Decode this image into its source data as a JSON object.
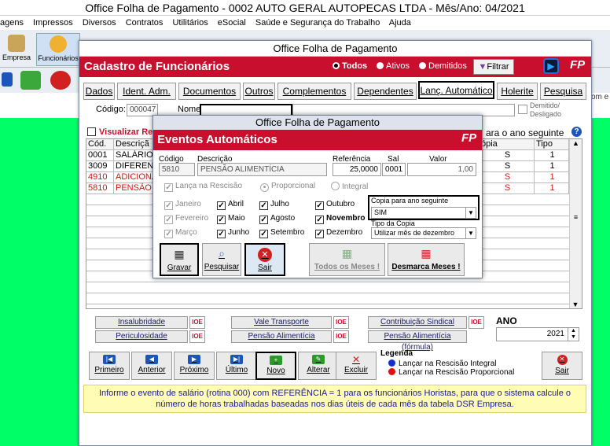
{
  "app": {
    "title": "Office Folha de Pagamento - 0002 AUTO GERAL AUTOPECAS LTDA - Mês/Ano: 04/2021",
    "menu": [
      "agens",
      "Impressos",
      "Diversos",
      "Contratos",
      "Utilitários",
      "eSocial",
      "Saúde e Segurança do Trabalho",
      "Ajuda"
    ],
    "toolbar": {
      "empresa": "Empresa",
      "funcionarios": "Funcionários"
    },
    "right_strip": "om e"
  },
  "cadastro": {
    "window_title": "Office Folha de Pagamento",
    "header_title": "Cadastro de Funcionários",
    "filters": {
      "todos": "Todos",
      "ativos": "Ativos",
      "demitidos": "Demitidos",
      "selected": "todos"
    },
    "filter_button": "Filtrar",
    "logo": "FP",
    "tabs": [
      "Dados",
      "Ident. Adm.",
      "Documentos",
      "Outros",
      "Complementos",
      "Dependentes",
      "Lanç. Automático",
      "Holerite",
      "Pesquisa"
    ],
    "active_tab": "Lanç. Automático",
    "codigo_label": "Código:",
    "codigo_value": "000047",
    "nome_label": "Nome:",
    "nome_value": "",
    "demitido_label": "Demitido/ Desligado",
    "visualizar_label": "Visualizar Ref",
    "copia_header": "ara o ano seguinte",
    "grid": {
      "headers": {
        "cod": "Cód.",
        "descricao": "Descriçã",
        "copia": "ópia",
        "tipo": "Tipo"
      },
      "rows": [
        {
          "cod": "0001",
          "descricao": "SALÁRIO",
          "copia": "S",
          "tipo": "1",
          "red": false
        },
        {
          "cod": "3009",
          "descricao": "DIFEREN",
          "copia": "S",
          "tipo": "1",
          "red": false
        },
        {
          "cod": "4910",
          "descricao": "ADICIONA",
          "copia": "S",
          "tipo": "1",
          "red": true
        },
        {
          "cod": "5810",
          "descricao": "PENSÃO",
          "copia": "S",
          "tipo": "1",
          "red": true
        }
      ]
    },
    "section_buttons": {
      "insalubridade": "Insalubridade",
      "periculosidade": "Periculosidade",
      "vale_transporte": "Vale Transporte",
      "pensao_alimenticia": "Pensão Alimentícia",
      "contribuicao_sindical": "Contribuição Sindical",
      "pensao_formula": "Pensão Alimentícia (fórmula)",
      "ioe": "IOE"
    },
    "ano_label": "ANO",
    "ano_value": "2021",
    "nav": {
      "primeiro": "Primeiro",
      "anterior": "Anterior",
      "proximo": "Próximo",
      "ultimo": "Último",
      "novo": "Novo",
      "alterar": "Alterar",
      "excluir": "Excluir",
      "sair": "Sair"
    },
    "legenda": {
      "title": "Legenda",
      "integral": "Lançar na Rescisão Integral",
      "proporcional": "Lançar na Rescisão Proporcional",
      "integral_color": "#1030d0",
      "proporcional_color": "#e01010"
    },
    "info": "Informe o evento de salário (rotina 000) com REFERÊNCIA = 1 para os funcionários Horistas, para que o sistema calcule o número de horas trabalhadas baseadas nos dias úteis de cada mês da tabela DSR Empresa."
  },
  "eventos": {
    "window_title": "Office Folha de Pagamento",
    "header_title": "Eventos Automáticos",
    "logo": "FP",
    "labels": {
      "codigo": "Código",
      "descricao": "Descrição",
      "referencia": "Referência",
      "sal": "Sal",
      "valor": "Valor"
    },
    "values": {
      "codigo": "5810",
      "descricao": "PENSÃO ALIMENTÍCIA",
      "referencia": "25,0000",
      "sal": "0001",
      "valor": "1,00"
    },
    "lancar_rescisao": "Lança na Rescisão",
    "proporcional": "Proporcional",
    "integral": "Integral",
    "months": {
      "janeiro": "Janeiro",
      "fevereiro": "Fevereiro",
      "marco": "Março",
      "abril": "Abril",
      "maio": "Maio",
      "junho": "Junho",
      "julho": "Julho",
      "agosto": "Agosto",
      "setembro": "Setembro",
      "outubro": "Outubro",
      "novembro": "Novembro",
      "dezembro": "Dezembro"
    },
    "copia_label": "Copia para ano seguinte",
    "copia_value": "SIM",
    "tipo_copia_label": "Tipo da Copia",
    "tipo_copia_value": "Utilizar mês de dezembro",
    "buttons": {
      "gravar": "Gravar",
      "pesquisar": "Pesquisar",
      "sair": "Sair",
      "todos_meses": "Todos os Meses !",
      "desmarca_meses": "Desmarca Meses !"
    }
  }
}
